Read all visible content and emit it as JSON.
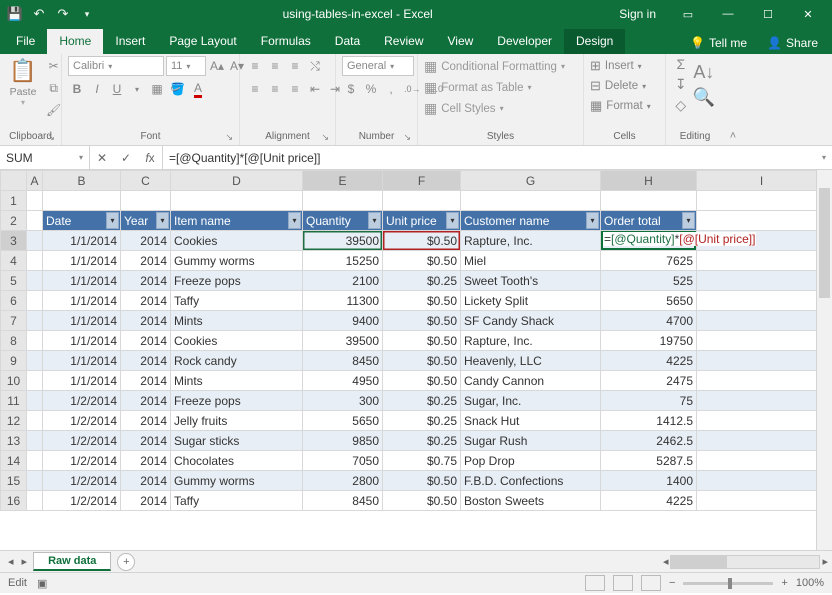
{
  "title": "using-tables-in-excel - Excel",
  "signin": "Sign in",
  "share": "Share",
  "tellme": "Tell me",
  "tabs": [
    "File",
    "Home",
    "Insert",
    "Page Layout",
    "Formulas",
    "Data",
    "Review",
    "View",
    "Developer",
    "Design"
  ],
  "ribbon": {
    "clipboard": {
      "paste": "Paste",
      "label": "Clipboard"
    },
    "font": {
      "name": "Calibri",
      "size": "11",
      "label": "Font"
    },
    "alignment": {
      "label": "Alignment"
    },
    "number": {
      "format": "General",
      "label": "Number"
    },
    "styles": {
      "cf": "Conditional Formatting",
      "fat": "Format as Table",
      "cs": "Cell Styles",
      "label": "Styles"
    },
    "cells": {
      "ins": "Insert",
      "del": "Delete",
      "fmt": "Format",
      "label": "Cells"
    },
    "editing": {
      "label": "Editing"
    }
  },
  "namebox": "SUM",
  "formula": "=[@Quantity]*[@[Unit price]]",
  "formula_parts": {
    "eq": "=",
    "q": "[@Quantity]",
    "mul": "*",
    "u": "[@[Unit price]]"
  },
  "cols": [
    "A",
    "B",
    "C",
    "D",
    "E",
    "F",
    "G",
    "H",
    "I"
  ],
  "headers": [
    "Date",
    "Year",
    "Item name",
    "Quantity",
    "Unit price",
    "Customer name",
    "Order total"
  ],
  "rows": [
    {
      "n": "3",
      "date": "1/1/2014",
      "year": "2014",
      "item": "Cookies",
      "qty": "39500",
      "price": "$0.50",
      "cust": "Rapture, Inc.",
      "total": ""
    },
    {
      "n": "4",
      "date": "1/1/2014",
      "year": "2014",
      "item": "Gummy worms",
      "qty": "15250",
      "price": "$0.50",
      "cust": "Miel",
      "total": "7625"
    },
    {
      "n": "5",
      "date": "1/1/2014",
      "year": "2014",
      "item": "Freeze pops",
      "qty": "2100",
      "price": "$0.25",
      "cust": "Sweet Tooth's",
      "total": "525"
    },
    {
      "n": "6",
      "date": "1/1/2014",
      "year": "2014",
      "item": "Taffy",
      "qty": "11300",
      "price": "$0.50",
      "cust": "Lickety Split",
      "total": "5650"
    },
    {
      "n": "7",
      "date": "1/1/2014",
      "year": "2014",
      "item": "Mints",
      "qty": "9400",
      "price": "$0.50",
      "cust": "SF Candy Shack",
      "total": "4700"
    },
    {
      "n": "8",
      "date": "1/1/2014",
      "year": "2014",
      "item": "Cookies",
      "qty": "39500",
      "price": "$0.50",
      "cust": "Rapture, Inc.",
      "total": "19750"
    },
    {
      "n": "9",
      "date": "1/1/2014",
      "year": "2014",
      "item": "Rock candy",
      "qty": "8450",
      "price": "$0.50",
      "cust": "Heavenly, LLC",
      "total": "4225"
    },
    {
      "n": "10",
      "date": "1/1/2014",
      "year": "2014",
      "item": "Mints",
      "qty": "4950",
      "price": "$0.50",
      "cust": "Candy Cannon",
      "total": "2475"
    },
    {
      "n": "11",
      "date": "1/2/2014",
      "year": "2014",
      "item": "Freeze pops",
      "qty": "300",
      "price": "$0.25",
      "cust": "Sugar, Inc.",
      "total": "75"
    },
    {
      "n": "12",
      "date": "1/2/2014",
      "year": "2014",
      "item": "Jelly fruits",
      "qty": "5650",
      "price": "$0.25",
      "cust": "Snack Hut",
      "total": "1412.5"
    },
    {
      "n": "13",
      "date": "1/2/2014",
      "year": "2014",
      "item": "Sugar sticks",
      "qty": "9850",
      "price": "$0.25",
      "cust": "Sugar Rush",
      "total": "2462.5"
    },
    {
      "n": "14",
      "date": "1/2/2014",
      "year": "2014",
      "item": "Chocolates",
      "qty": "7050",
      "price": "$0.75",
      "cust": "Pop Drop",
      "total": "5287.5"
    },
    {
      "n": "15",
      "date": "1/2/2014",
      "year": "2014",
      "item": "Gummy worms",
      "qty": "2800",
      "price": "$0.50",
      "cust": "F.B.D. Confections",
      "total": "1400"
    },
    {
      "n": "16",
      "date": "1/2/2014",
      "year": "2014",
      "item": "Taffy",
      "qty": "8450",
      "price": "$0.50",
      "cust": "Boston Sweets",
      "total": "4225"
    }
  ],
  "sheet_tab": "Raw data",
  "status": {
    "mode": "Edit",
    "zoom": "100%"
  }
}
